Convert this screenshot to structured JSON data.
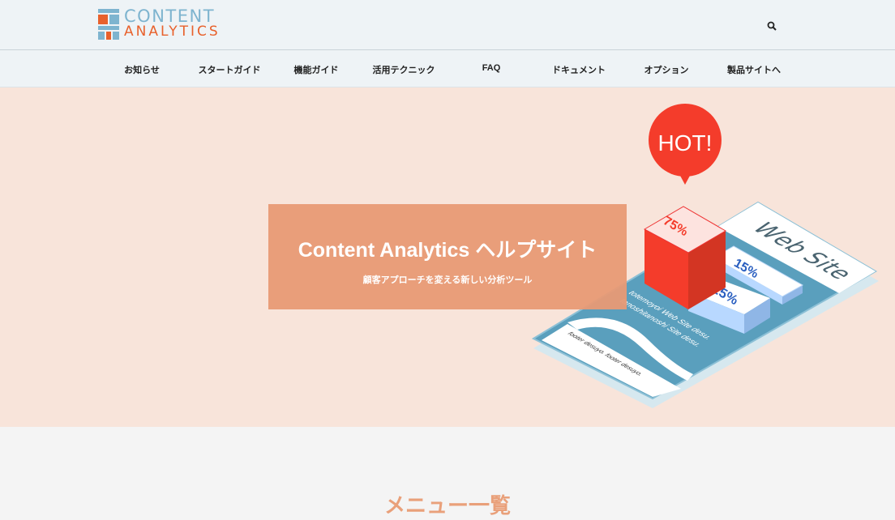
{
  "header": {
    "logo": {
      "line1": "CONTENT",
      "line2": "ANALYTICS"
    },
    "search_icon": "search-icon"
  },
  "nav": {
    "items": [
      {
        "label": "お知らせ"
      },
      {
        "label": "スタートガイド"
      },
      {
        "label": "機能ガイド"
      },
      {
        "label": "活用テクニック"
      },
      {
        "label": "FAQ"
      },
      {
        "label": "ドキュメント"
      },
      {
        "label": "オプション"
      },
      {
        "label": "製品サイトへ"
      }
    ]
  },
  "hero": {
    "title": "Content Analytics ヘルプサイト",
    "subtitle": "顧客アプローチを変える新しい分析ツール",
    "illustration": {
      "badge": "HOT!",
      "site_label": "Web Site",
      "bar_values": [
        "75%",
        "15%",
        "25%"
      ],
      "body_line1": "totemoyoi Web Site desu.",
      "body_line2": "tanoshitanoshi Site desu.",
      "footer_text": "footer desuyo. footer desuyo."
    }
  },
  "section": {
    "title": "メニュー一覧"
  },
  "colors": {
    "accent": "#e8612c",
    "logo_blue": "#7eb4cf",
    "hero_bg": "#f8e4da",
    "banner": "#e89a75",
    "hot": "#f43c2b"
  }
}
